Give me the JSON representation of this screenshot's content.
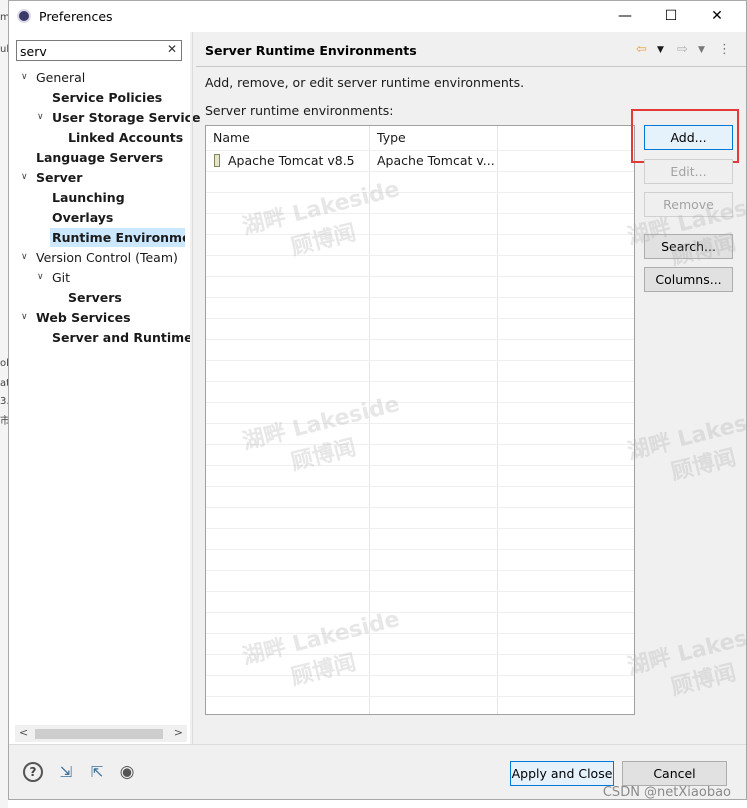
{
  "window": {
    "title": "Preferences",
    "minimize": "—",
    "maximize": "☐",
    "close": "✕"
  },
  "filter": {
    "value": "serv"
  },
  "tree": {
    "general": "General",
    "service_policies": "Service Policies",
    "user_storage": "User Storage Service",
    "linked_accounts": "Linked Accounts",
    "language_servers": "Language Servers",
    "server": "Server",
    "launching": "Launching",
    "overlays": "Overlays",
    "runtime_env": "Runtime Environmen",
    "version_control": "Version Control (Team)",
    "git": "Git",
    "servers": "Servers",
    "web_services": "Web Services",
    "server_and_runtime": "Server and Runtime"
  },
  "page": {
    "title": "Server Runtime Environments",
    "description": "Add, remove, or edit server runtime environments.",
    "list_label": "Server runtime environments:"
  },
  "table": {
    "headers": [
      "Name",
      "Type"
    ],
    "rows": [
      [
        "Apache Tomcat v8.5",
        "Apache Tomcat v..."
      ]
    ]
  },
  "buttons": {
    "add": "Add...",
    "edit": "Edit...",
    "remove": "Remove",
    "search": "Search...",
    "columns": "Columns..."
  },
  "footer": {
    "apply_close": "Apply and Close",
    "cancel": "Cancel"
  },
  "watermark": {
    "line1": "湖畔 Lakeside",
    "line2": "顾博闻",
    "csdn": "CSDN @netXiaobao"
  },
  "behind_window": {
    "l1": "mp",
    "l2": "ub",
    "l3": "ol",
    "l4": "at",
    "l5": "3.",
    "l6": "市"
  }
}
